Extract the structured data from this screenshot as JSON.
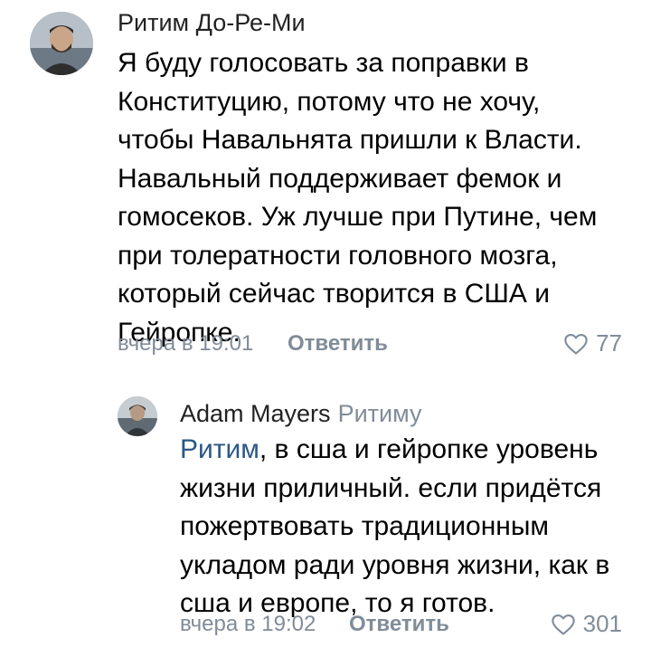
{
  "comment": {
    "author": "Ритим До-Ре-Ми",
    "text": "Я буду голосовать за поправки в Конституцию, потому что не хочу, чтобы Навальнята пришли к Власти. Навальный поддерживает фемок и гомосеков. Уж лучше при Путине, чем при толератности головного мозга, который сейчас творится в США и Гейропке.",
    "time": "вчера в 19:01",
    "reply_label": "Ответить",
    "likes": "77",
    "avatar_icon": "person-avatar"
  },
  "reply": {
    "author": "Adam Mayers",
    "reply_to": "Ритиму",
    "mention": "Ритим",
    "text": ", в сша и гейропке уровень жизни приличный. если придётся пожертвовать традиционным укладом ради уровня жизни, как в сша и европе, то я готов.",
    "time": "вчера в 19:02",
    "reply_label": "Ответить",
    "likes": "301",
    "avatar_icon": "person-avatar"
  },
  "colors": {
    "link": "#2a5885",
    "meta": "#818c99"
  }
}
